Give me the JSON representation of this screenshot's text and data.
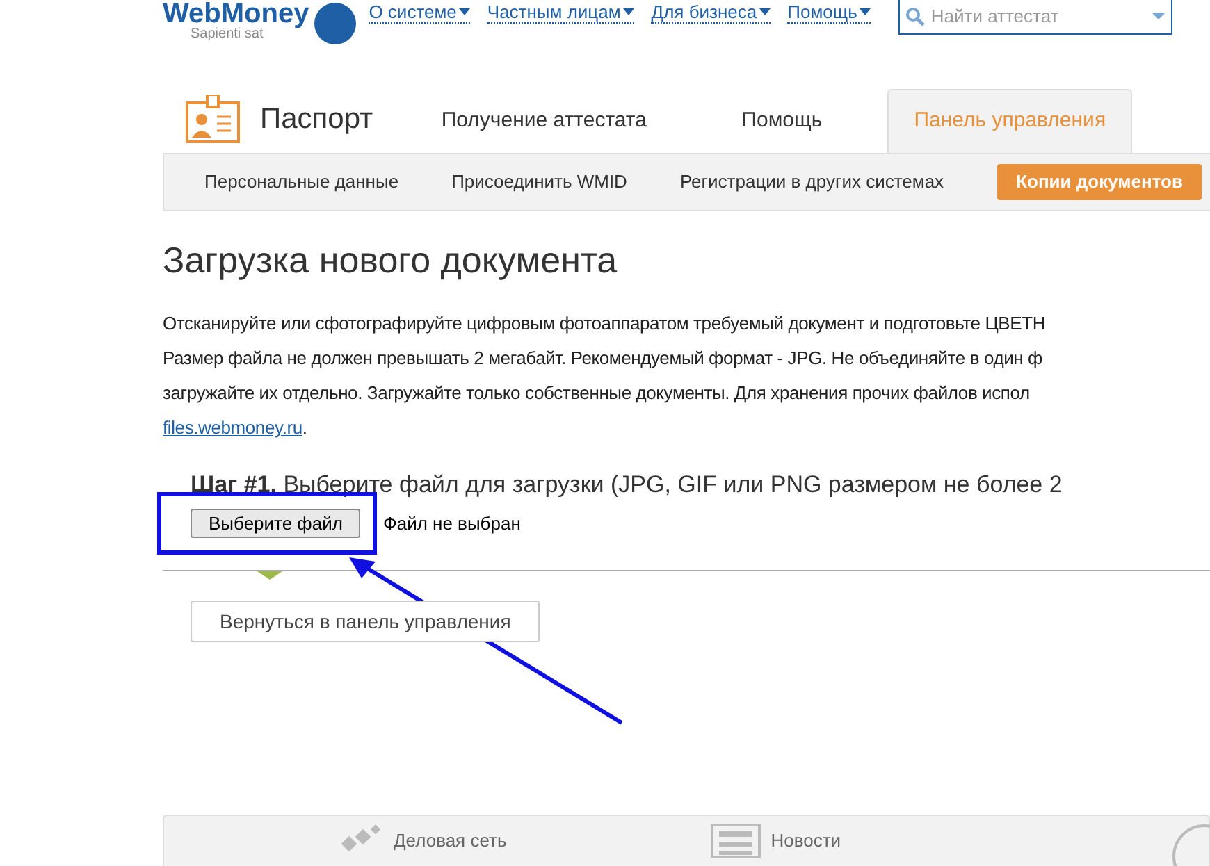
{
  "header": {
    "logo_text": "WebMoney",
    "logo_tagline": "Sapienti sat",
    "nav": [
      {
        "label": "О системе"
      },
      {
        "label": "Частным лицам"
      },
      {
        "label": "Для бизнеса"
      },
      {
        "label": "Помощь"
      }
    ],
    "search": {
      "placeholder": "Найти аттестат"
    }
  },
  "service": {
    "title": "Паспорт",
    "tabs": [
      {
        "label": "Получение аттестата",
        "selected": false
      },
      {
        "label": "Помощь",
        "selected": false
      },
      {
        "label": "Панель управления",
        "selected": true
      }
    ]
  },
  "subnav": [
    {
      "label": "Персональные данные",
      "selected": false
    },
    {
      "label": "Присоединить WMID",
      "selected": false
    },
    {
      "label": "Регистрации в других системах",
      "selected": false
    },
    {
      "label": "Копии документов",
      "selected": true
    }
  ],
  "page_title": "Загрузка нового документа",
  "intro": {
    "lines": [
      "Отсканируйте или сфотографируйте цифровым фотоаппаратом требуемый документ и подготовьте ЦВЕТН",
      "Размер файла не должен превышать 2 мегабайт. Рекомендуемый формат - JPG. Не объединяйте в один ф",
      "загружайте их отдельно. Загружайте только собственные документы. Для хранения прочих файлов испол"
    ],
    "link": "files.webmoney.ru",
    "tail": "."
  },
  "step": {
    "heading": "**Шаг #1.** Выберите файл для загрузки (JPG, GIF или PNG размером не более 2",
    "file_button": "Выберите файл",
    "file_status": "Файл не выбран"
  },
  "back_button": "Вернуться в панель управления",
  "footer": [
    {
      "label": "Деловая сеть"
    },
    {
      "label": "Новости"
    }
  ]
}
